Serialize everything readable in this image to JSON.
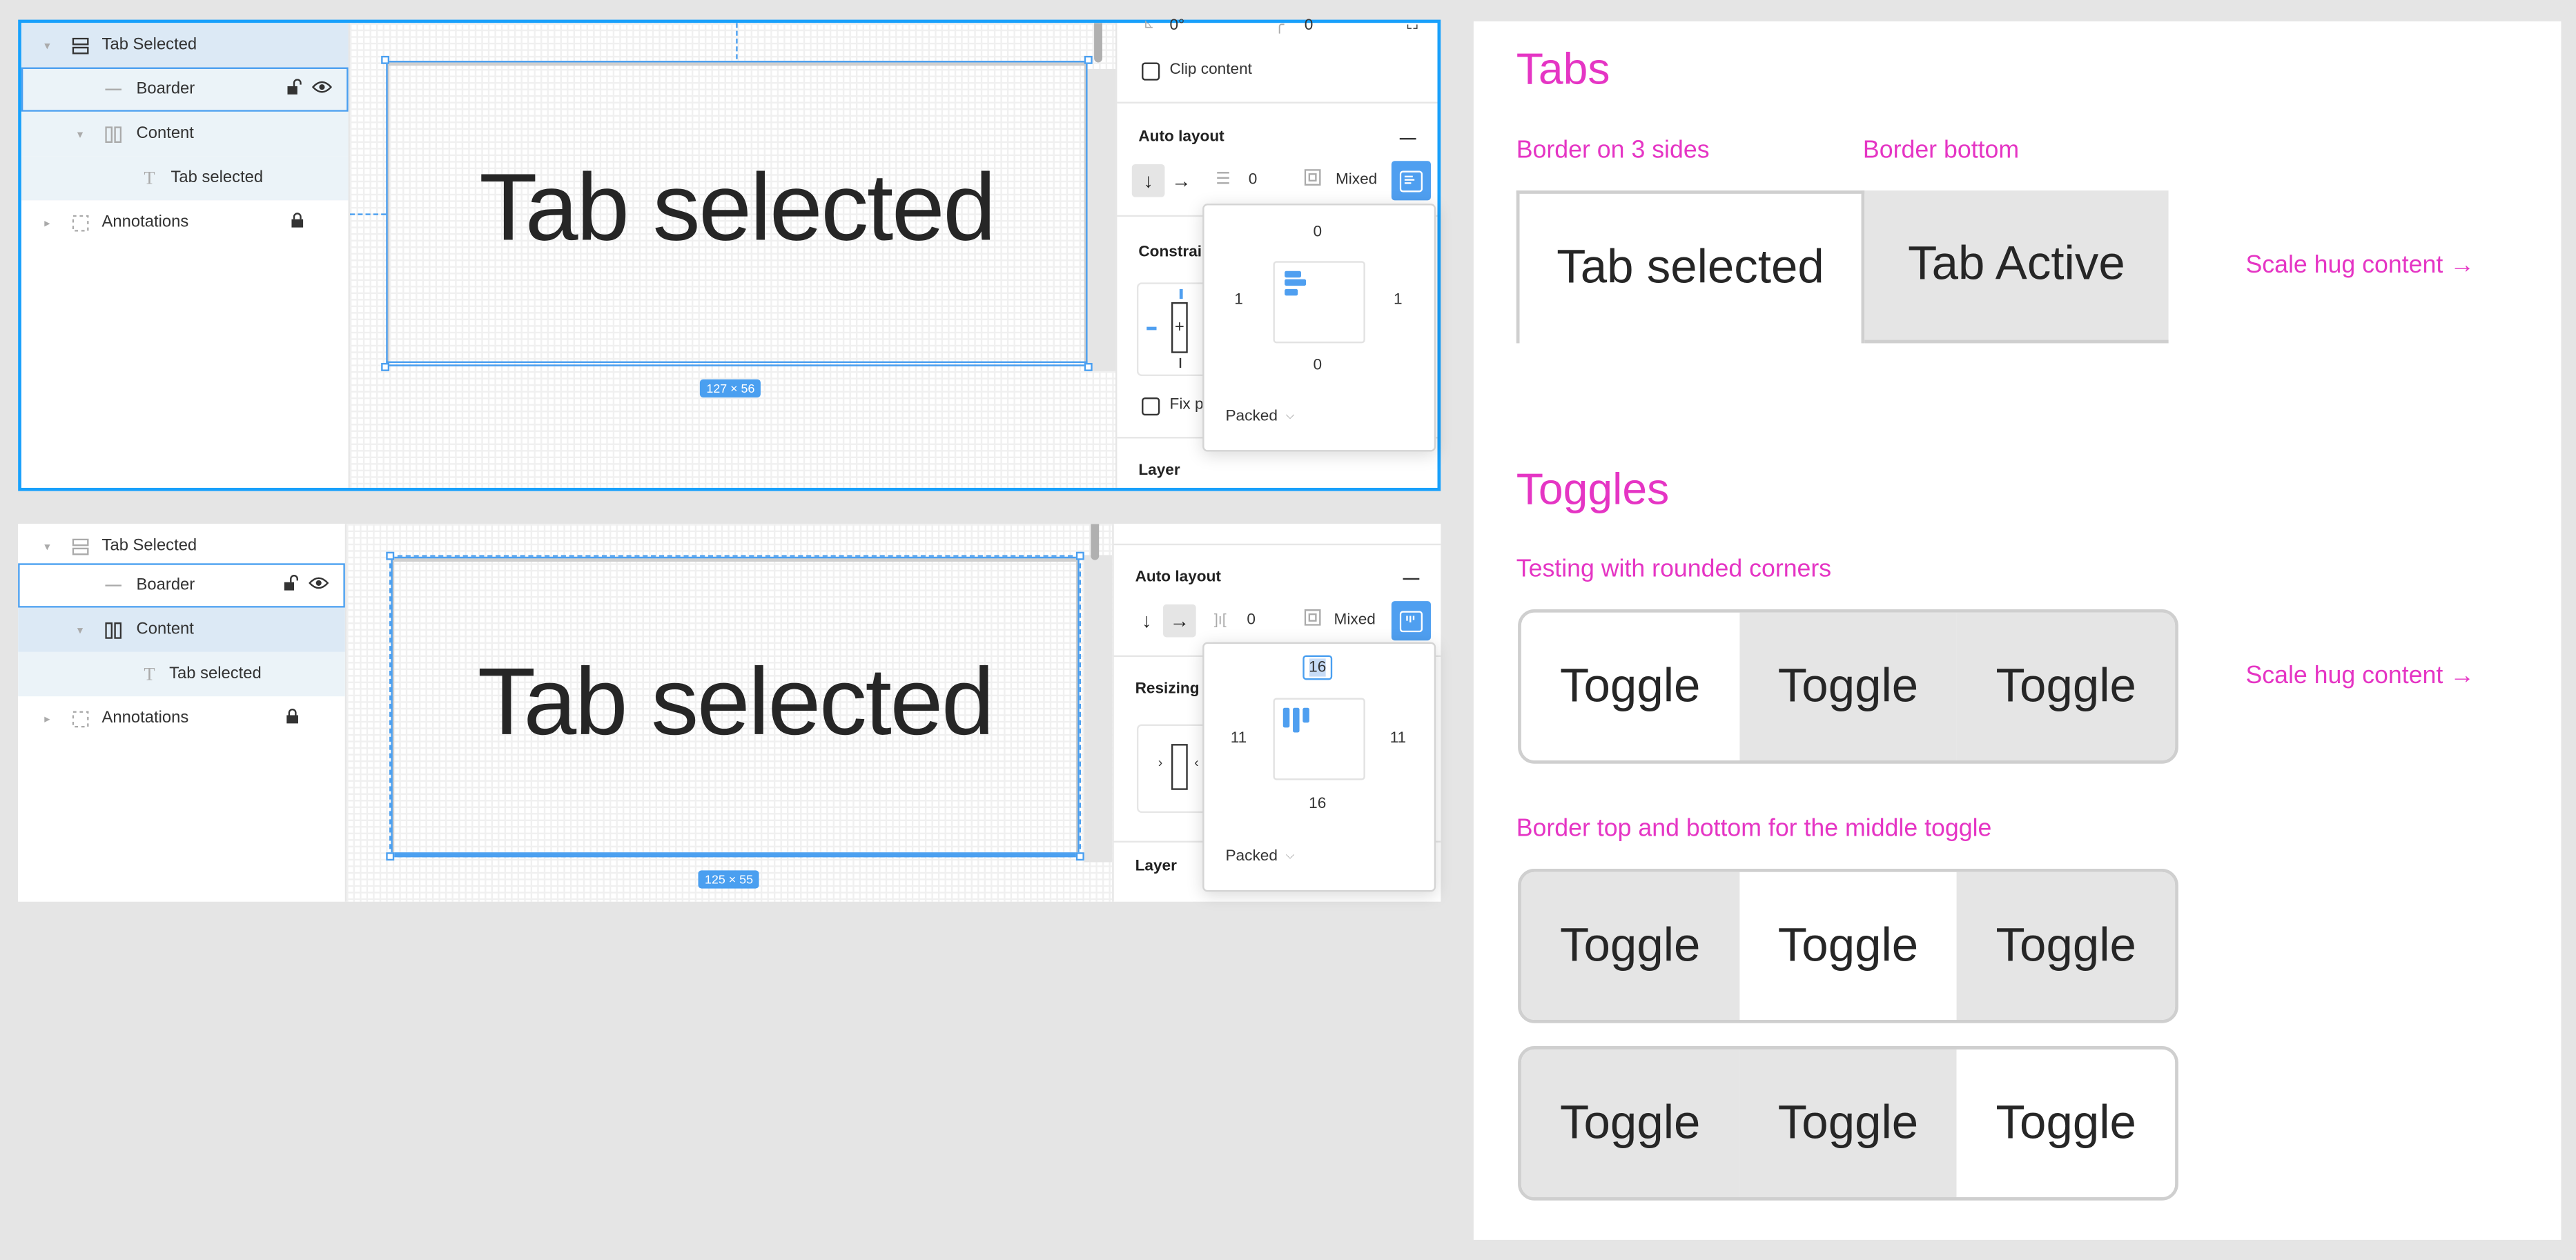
{
  "colors": {
    "selection_blue": "#18a0fb",
    "accent_blue": "#4f9ff0",
    "annotation_pink": "#e535c4",
    "toggle_inactive": "#e5e5e5",
    "border_gray": "#cfcfcf"
  },
  "editor_top": {
    "layers": [
      {
        "name": "Tab Selected",
        "icon": "vertical-autolayout-icon",
        "caret": "▾",
        "state": "selected"
      },
      {
        "name": "Boarder",
        "icon": "line-icon",
        "lock": "unlocked-icon",
        "visibility": "eye-icon",
        "state": "hovered"
      },
      {
        "name": "Content",
        "icon": "horizontal-autolayout-icon",
        "caret": "▾",
        "state": "child"
      },
      {
        "name": "Tab selected",
        "icon": "text-icon",
        "state": "child"
      },
      {
        "name": "Annotations",
        "icon": "frame-dashed-icon",
        "caret": "▸",
        "lock": "locked-icon"
      }
    ],
    "canvas": {
      "text": "Tab selected",
      "dimensions": "127 × 56"
    },
    "props": {
      "rotation": "0°",
      "radius": "0",
      "clip_content_label": "Clip content",
      "auto_layout_title": "Auto layout",
      "direction_down": "↓",
      "direction_right": "→",
      "spacing": "0",
      "padding": "Mixed",
      "constraints_title": "Constrain",
      "fix_position_label": "Fix p",
      "layer_title": "Layer"
    },
    "popover": {
      "top": "0",
      "left": "1",
      "right": "1",
      "bottom": "0",
      "distribution": "Packed"
    }
  },
  "editor_bottom": {
    "layers": [
      {
        "name": "Tab Selected",
        "icon": "vertical-autolayout-icon",
        "caret": "▾"
      },
      {
        "name": "Boarder",
        "icon": "line-icon",
        "lock": "unlocked-icon",
        "visibility": "eye-icon",
        "state": "hovered"
      },
      {
        "name": "Content",
        "icon": "horizontal-autolayout-icon",
        "caret": "▾",
        "state": "selected"
      },
      {
        "name": "Tab selected",
        "icon": "text-icon",
        "state": "child"
      },
      {
        "name": "Annotations",
        "icon": "frame-dashed-icon",
        "caret": "▸",
        "lock": "locked-icon"
      }
    ],
    "canvas": {
      "text": "Tab selected",
      "dimensions": "125 × 55"
    },
    "props": {
      "auto_layout_title": "Auto layout",
      "direction_down": "↓",
      "direction_right": "→",
      "spacing": "0",
      "padding": "Mixed",
      "resizing_title": "Resizing",
      "layer_title": "Layer"
    },
    "popover": {
      "top": "16",
      "left": "11",
      "right": "11",
      "bottom": "16",
      "distribution": "Packed"
    }
  },
  "doc": {
    "tabs_title": "Tabs",
    "tabs_label_1": "Border on 3 sides",
    "tabs_label_2": "Border bottom",
    "tab_selected": "Tab selected",
    "tab_active": "Tab Active",
    "scale_note_1": "Scale hug content →",
    "toggles_title": "Toggles",
    "toggles_label_1": "Testing with rounded corners",
    "scale_note_2": "Scale hug content →",
    "toggles_label_2": "Border top and bottom for the middle toggle",
    "toggle_groups": [
      {
        "selected_index": 0,
        "items": [
          "Toggle",
          "Toggle",
          "Toggle"
        ]
      },
      {
        "selected_index": 1,
        "items": [
          "Toggle",
          "Toggle",
          "Toggle"
        ]
      },
      {
        "selected_index": 2,
        "items": [
          "Toggle",
          "Toggle",
          "Toggle"
        ]
      }
    ]
  }
}
